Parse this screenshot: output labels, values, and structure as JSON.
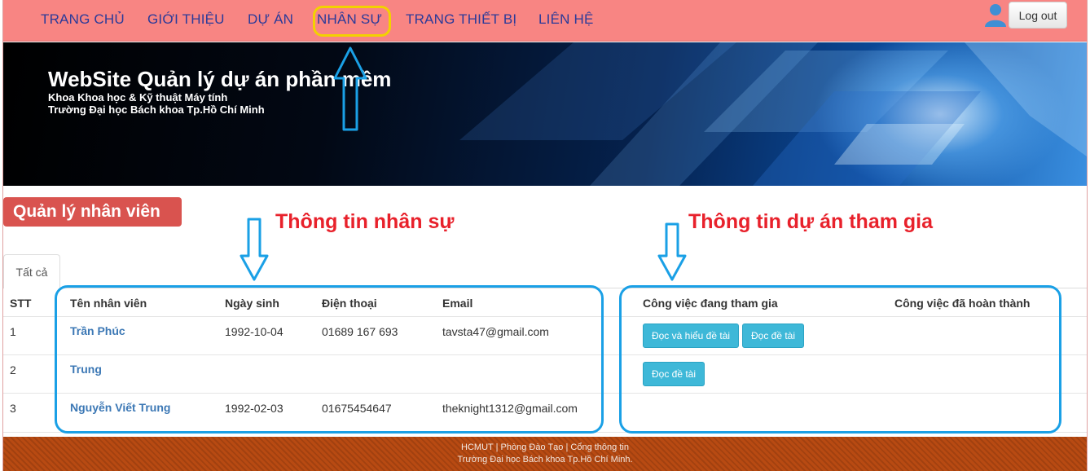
{
  "nav": {
    "items": [
      "TRANG CHỦ",
      "GIỚI THIỆU",
      "DỰ ÁN",
      "NHÂN SỰ",
      "TRANG THIẾT BỊ",
      "LIÊN HỆ"
    ],
    "logout_label": "Log out",
    "user_icon": "user-icon"
  },
  "banner": {
    "title": "WebSite Quản lý dự án phần mềm",
    "subtitle1": "Khoa Khoa học & Kỹ thuật Máy tính",
    "subtitle2": "Trường Đại học Bách khoa Tp.Hồ Chí Minh"
  },
  "page": {
    "title": "Quản lý nhân viên",
    "annotation_left": "Thông tin nhân sự",
    "annotation_right": "Thông tin dự án tham gia",
    "tab_all": "Tất cả"
  },
  "table": {
    "headers": {
      "stt": "STT",
      "name": "Tên nhân viên",
      "birth": "Ngày sinh",
      "phone": "Điện thoại",
      "email": "Email",
      "current": "Công việc đang tham gia",
      "done": "Công việc đã hoàn thành"
    },
    "rows": [
      {
        "stt": "1",
        "name": "Trần Phúc",
        "birth": "1992-10-04",
        "phone": "01689 167 693",
        "email": "tavsta47@gmail.com",
        "tasks": [
          "Đọc và hiểu đề tài",
          "Đọc đề tài"
        ]
      },
      {
        "stt": "2",
        "name": "Trung",
        "birth": "",
        "phone": "",
        "email": "",
        "tasks": [
          "Đọc đề tài"
        ]
      },
      {
        "stt": "3",
        "name": "Nguyễn Viết Trung",
        "birth": "1992-02-03",
        "phone": "01675454647",
        "email": "theknight1312@gmail.com",
        "tasks": []
      }
    ]
  },
  "footer": {
    "link1": "HCMUT",
    "link2": "Phòng Đào Tạo",
    "link3": "Cổng thông tin",
    "separator": "|",
    "line2": "Trường Đại học Bách khoa Tp.Hồ Chí Minh."
  },
  "colors": {
    "nav_bg": "#f88583",
    "nav_text": "#2b3a99",
    "highlight": "#f2d200",
    "annotation": "#e8212b",
    "box_border": "#1aa0e6",
    "title_bg": "#d9534f",
    "button_info": "#3eb8d8",
    "footer_bg": "#b84a12"
  }
}
